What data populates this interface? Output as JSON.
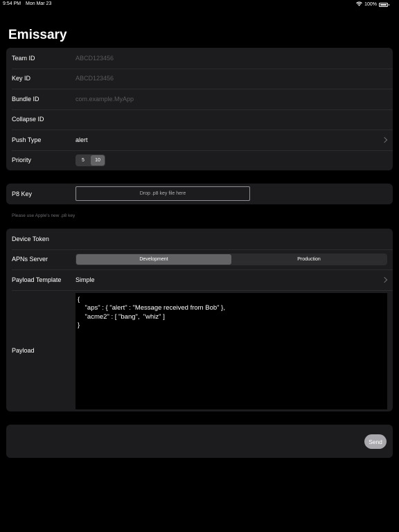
{
  "status_bar": {
    "time": "9:54 PM",
    "date": "Mon Mar 23",
    "battery": "100%",
    "icons": [
      "wifi-icon",
      "battery-icon"
    ]
  },
  "app": {
    "title": "Emissary"
  },
  "config_section": {
    "team_id": {
      "label": "Team ID",
      "value": "",
      "placeholder": "ABCD123456"
    },
    "key_id": {
      "label": "Key ID",
      "value": "",
      "placeholder": "ABCD123456"
    },
    "bundle_id": {
      "label": "Bundle ID",
      "value": "",
      "placeholder": "com.example.MyApp"
    },
    "collapse_id": {
      "label": "Collapse ID",
      "value": "",
      "placeholder": ""
    },
    "push_type": {
      "label": "Push Type",
      "value": "alert",
      "icon": "chevron-right-icon"
    },
    "priority": {
      "label": "Priority",
      "options": [
        "5",
        "10"
      ],
      "selected": "10"
    }
  },
  "key_section": {
    "p8_key": {
      "label": "P8 Key",
      "drop_text": "Drop .p8 key file here"
    },
    "footnote": "Please use Apple's new .p8 key"
  },
  "message_section": {
    "device_token": {
      "label": "Device Token",
      "value": ""
    },
    "apns_server": {
      "label": "APNs Server",
      "options": [
        "Development",
        "Production"
      ],
      "selected": "Development"
    },
    "payload_template": {
      "label": "Payload Template",
      "value": "Simple",
      "icon": "chevron-right-icon"
    },
    "payload": {
      "label": "Payload",
      "text": "{\n    \"aps\" : { \"alert\" : \"Message received from Bob\" },\n    \"acme2\" : [ \"bang\",  \"whiz\" ]\n}"
    }
  },
  "actions": {
    "send_label": "Send"
  },
  "colors": {
    "background": "#000000",
    "group_background": "#1c1c1e",
    "separator": "#2c2c2e",
    "placeholder": "#5a5a5e",
    "selected_segment": "#636366",
    "send_button": "#a8a8ad"
  }
}
